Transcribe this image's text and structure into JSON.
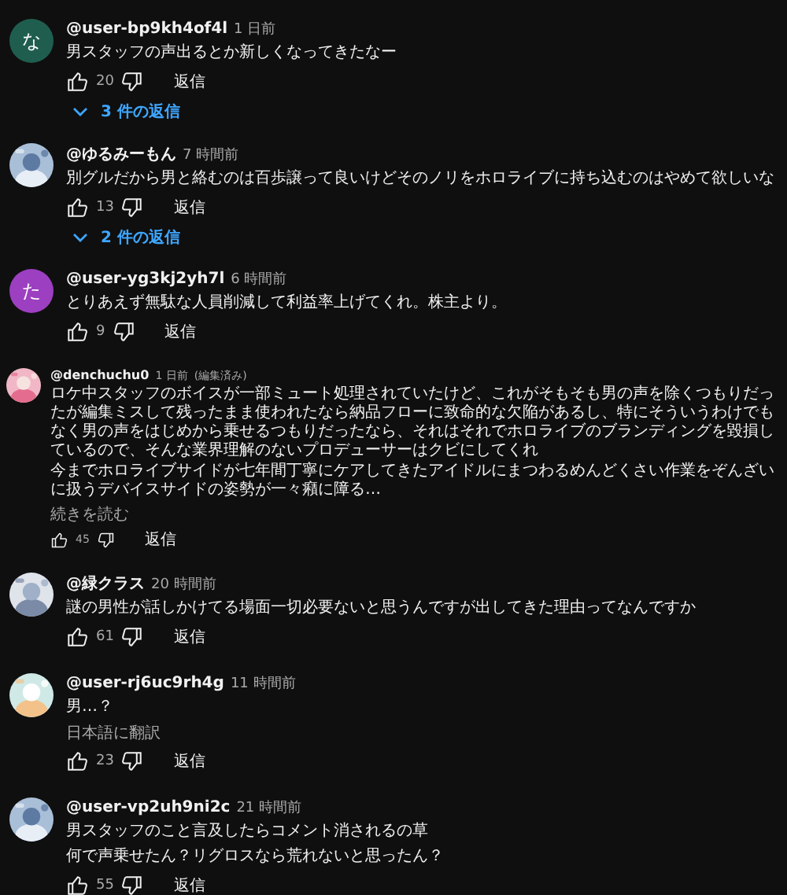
{
  "comments": [
    {
      "kind": "regular",
      "avatar": {
        "kind": "letter",
        "letter": "な",
        "color": "#1f5e4f"
      },
      "author": "@user-bp9kh4of4l",
      "time": "1 日前",
      "text": [
        "男スタッフの声出るとか新しくなってきたなー"
      ],
      "likes": "20",
      "reply": "返信",
      "replies": "3 件の返信"
    },
    {
      "kind": "regular",
      "avatar": {
        "kind": "picture"
      },
      "author": "@ゆるみーもん",
      "time": "7 時間前",
      "text": [
        "別グルだから男と絡むのは百歩譲って良いけどそのノリをホロライブに持ち込むのはやめて欲しいな"
      ],
      "likes": "13",
      "reply": "返信",
      "replies": "2 件の返信"
    },
    {
      "kind": "regular",
      "avatar": {
        "kind": "letter",
        "letter": "た",
        "color": "#9c3fc0"
      },
      "author": "@user-yg3kj2yh7l",
      "time": "6 時間前",
      "text": [
        "とりあえず無駄な人員削減して利益率上げてくれ。株主より。"
      ],
      "likes": "9",
      "reply": "返信"
    },
    {
      "kind": "compact",
      "avatar": {
        "kind": "picture"
      },
      "author": "@denchuchu0",
      "time": "1 日前",
      "edited": "(編集済み)",
      "text": [
        "ロケ中スタッフのボイスが一部ミュート処理されていたけど、これがそもそも男の声を除くつもりだったが編集ミスして残ったまま使われたなら納品フローに致命的な欠陥があるし、特にそういうわけでもなく男の声をはじめから乗せるつもりだったなら、それはそれでホロライブのブランディングを毀損しているので、そんな業界理解のないプロデューサーはクビにしてくれ",
        "今までホロライブサイドが七年間丁寧にケアしてきたアイドルにまつわるめんどくさい作業をぞんざいに扱うデバイスサイドの姿勢が一々癪に障る…"
      ],
      "read_more": "続きを読む",
      "likes": "45",
      "reply": "返信"
    },
    {
      "kind": "regular",
      "avatar": {
        "kind": "picture"
      },
      "author": "@緑クラス",
      "time": "20 時間前",
      "text": [
        "謎の男性が話しかけてる場面一切必要ないと思うんですが出してきた理由ってなんですか"
      ],
      "likes": "61",
      "reply": "返信"
    },
    {
      "kind": "regular",
      "avatar": {
        "kind": "picture"
      },
      "author": "@user-rj6uc9rh4g",
      "time": "11 時間前",
      "text": [
        "男…？"
      ],
      "translate": "日本語に翻訳",
      "likes": "23",
      "reply": "返信"
    },
    {
      "kind": "regular",
      "avatar": {
        "kind": "picture"
      },
      "author": "@user-vp2uh9ni2c",
      "time": "21 時間前",
      "text": [
        "男スタッフのこと言及したらコメント消されるの草",
        "何で声乗せたん？リグロスなら荒れないと思ったん？"
      ],
      "likes": "55",
      "reply": "返信"
    }
  ]
}
